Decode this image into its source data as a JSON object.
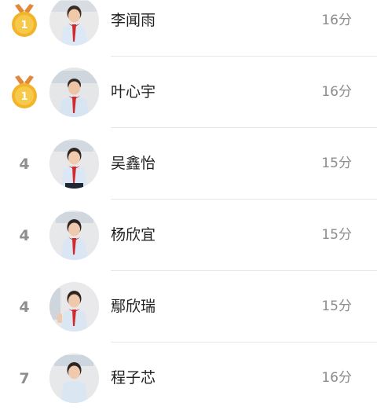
{
  "leaderboard": {
    "rows": [
      {
        "rank": "1",
        "rank_icon": "gold-medal-icon",
        "avatar": "student-avatar-photo",
        "name": "李闻雨",
        "score": "16分"
      },
      {
        "rank": "1",
        "rank_icon": "gold-medal-icon",
        "avatar": "student-avatar-photo",
        "name": "叶心宇",
        "score": "16分"
      },
      {
        "rank": "4",
        "rank_icon": "",
        "avatar": "student-avatar-photo",
        "name": "吴鑫怡",
        "score": "15分"
      },
      {
        "rank": "4",
        "rank_icon": "",
        "avatar": "student-avatar-photo",
        "name": "杨欣宜",
        "score": "15分"
      },
      {
        "rank": "4",
        "rank_icon": "",
        "avatar": "student-avatar-photo",
        "name": "鄢欣瑞",
        "score": "15分"
      },
      {
        "rank": "7",
        "rank_icon": "",
        "avatar": "student-avatar-photo",
        "name": "程子芯",
        "score": "16分"
      }
    ]
  },
  "colors": {
    "medal_gold": "#f2b529",
    "medal_ribbon": "#e0893a",
    "rank_text": "#8f8f8f",
    "name_text": "#1f1f1f",
    "score_text": "#8c8c8c",
    "divider": "#e6e6e6"
  }
}
